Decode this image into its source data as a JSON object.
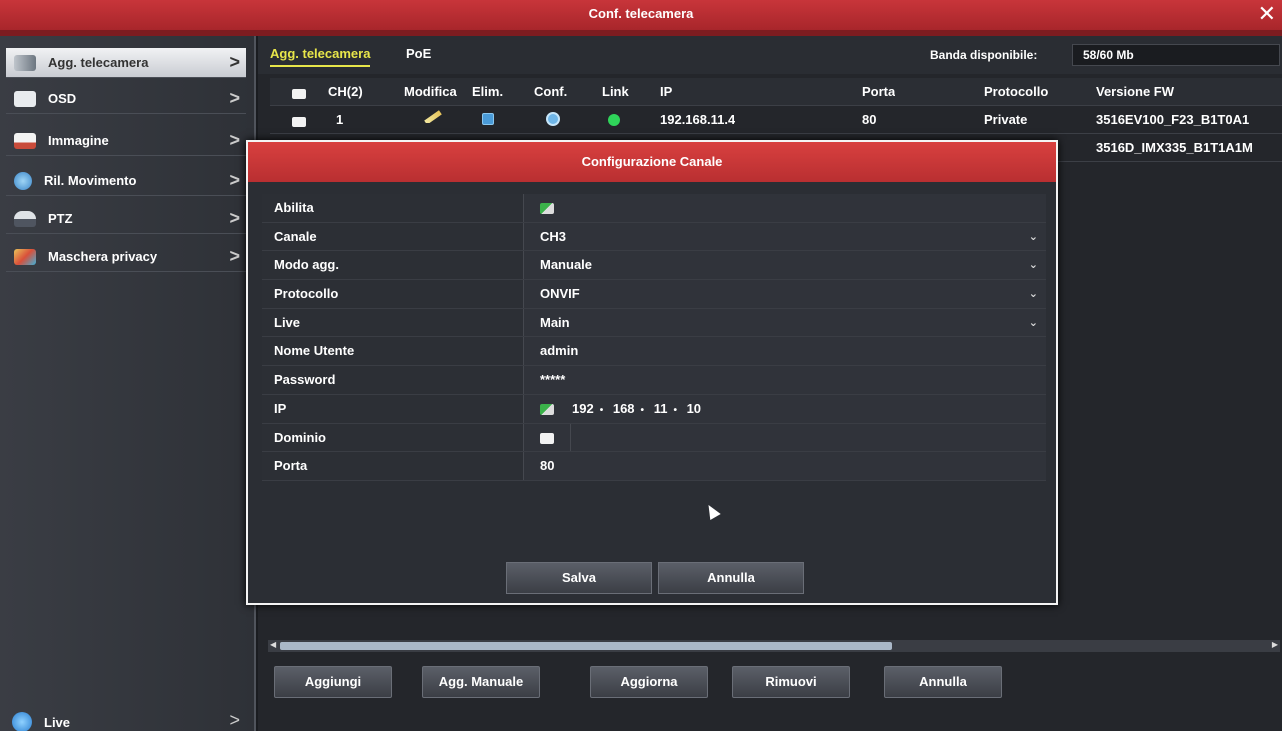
{
  "window": {
    "title": "Conf. telecamera",
    "close_label": "✕"
  },
  "sidebar": {
    "items": [
      {
        "label": "Agg. telecamera",
        "icon": "camera-icon"
      },
      {
        "label": "OSD",
        "icon": "osd-icon"
      },
      {
        "label": "Immagine",
        "icon": "image-icon"
      },
      {
        "label": "Ril. Movimento",
        "icon": "motion-icon"
      },
      {
        "label": "PTZ",
        "icon": "ptz-icon"
      },
      {
        "label": "Maschera privacy",
        "icon": "privacy-icon"
      }
    ],
    "live_label": "Live",
    "chevron": ">"
  },
  "tabs": [
    {
      "label": "Agg. telecamera"
    },
    {
      "label": "PoE"
    }
  ],
  "bandwidth": {
    "label": "Banda disponibile:",
    "value": "58/60 Mb"
  },
  "table": {
    "headers": [
      "CH(2)",
      "Modifica",
      "Elim.",
      "Conf.",
      "Link",
      "IP",
      "Porta",
      "Protocollo",
      "Versione FW"
    ],
    "rows": [
      {
        "ch": "1",
        "ip": "192.168.11.4",
        "port": "80",
        "protocol": "Private",
        "fw": "3516EV100_F23_B1T0A1"
      },
      {
        "ch": "",
        "ip": "",
        "port": "",
        "protocol": "",
        "fw": "3516D_IMX335_B1T1A1M"
      }
    ]
  },
  "bottom_buttons": [
    "Aggiungi",
    "Agg. Manuale",
    "Aggiorna",
    "Rimuovi",
    "Annulla"
  ],
  "dialog": {
    "title": "Configurazione Canale",
    "fields": {
      "abilita": {
        "label": "Abilita"
      },
      "canale": {
        "label": "Canale",
        "value": "CH3"
      },
      "modo": {
        "label": "Modo agg.",
        "value": "Manuale"
      },
      "protocollo": {
        "label": "Protocollo",
        "value": "ONVIF"
      },
      "live": {
        "label": "Live",
        "value": "Main"
      },
      "utente": {
        "label": "Nome Utente",
        "value": "admin"
      },
      "password": {
        "label": "Password",
        "value": "*****"
      },
      "ip": {
        "label": "IP",
        "seg1": "192",
        "seg2": "168",
        "seg3": "11",
        "seg4": "10"
      },
      "dominio": {
        "label": "Dominio"
      },
      "porta": {
        "label": "Porta",
        "value": "80"
      }
    },
    "save_label": "Salva",
    "cancel_label": "Annulla"
  }
}
